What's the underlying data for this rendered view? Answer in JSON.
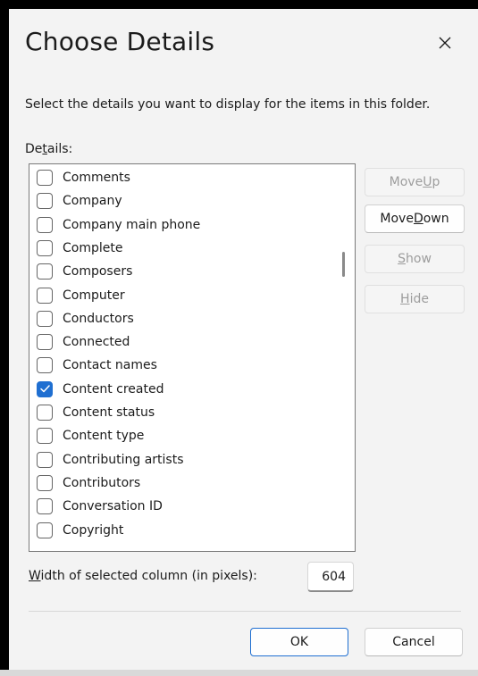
{
  "dialog": {
    "title": "Choose Details",
    "close_glyph": "×",
    "instructions": "Select the details you want to display for the items in this folder.",
    "details_label_prefix": "De",
    "details_label_mnemonic": "t",
    "details_label_suffix": "ails:"
  },
  "details_list": [
    {
      "label": "Comments",
      "checked": false
    },
    {
      "label": "Company",
      "checked": false
    },
    {
      "label": "Company main phone",
      "checked": false
    },
    {
      "label": "Complete",
      "checked": false
    },
    {
      "label": "Composers",
      "checked": false
    },
    {
      "label": "Computer",
      "checked": false
    },
    {
      "label": "Conductors",
      "checked": false
    },
    {
      "label": "Connected",
      "checked": false
    },
    {
      "label": "Contact names",
      "checked": false
    },
    {
      "label": "Content created",
      "checked": true
    },
    {
      "label": "Content status",
      "checked": false
    },
    {
      "label": "Content type",
      "checked": false
    },
    {
      "label": "Contributing artists",
      "checked": false
    },
    {
      "label": "Contributors",
      "checked": false
    },
    {
      "label": "Conversation ID",
      "checked": false
    },
    {
      "label": "Copyright",
      "checked": false
    }
  ],
  "side_buttons": {
    "move_up": {
      "prefix": "Move ",
      "mnemonic": "U",
      "suffix": "p",
      "enabled": false
    },
    "move_down": {
      "prefix": "Move ",
      "mnemonic": "D",
      "suffix": "own",
      "enabled": true
    },
    "show": {
      "prefix": "",
      "mnemonic": "S",
      "suffix": "how",
      "enabled": false
    },
    "hide": {
      "prefix": "",
      "mnemonic": "H",
      "suffix": "ide",
      "enabled": false
    }
  },
  "width_field": {
    "label_mnemonic": "W",
    "label_rest": "idth of selected column (in pixels):",
    "value": "604"
  },
  "footer": {
    "ok_label": "OK",
    "cancel_label": "Cancel"
  },
  "colors": {
    "accent": "#1f6fd1",
    "dialog_background": "#f3f3f3"
  },
  "icons": {
    "close": "close-icon",
    "check": "checkmark-icon"
  }
}
